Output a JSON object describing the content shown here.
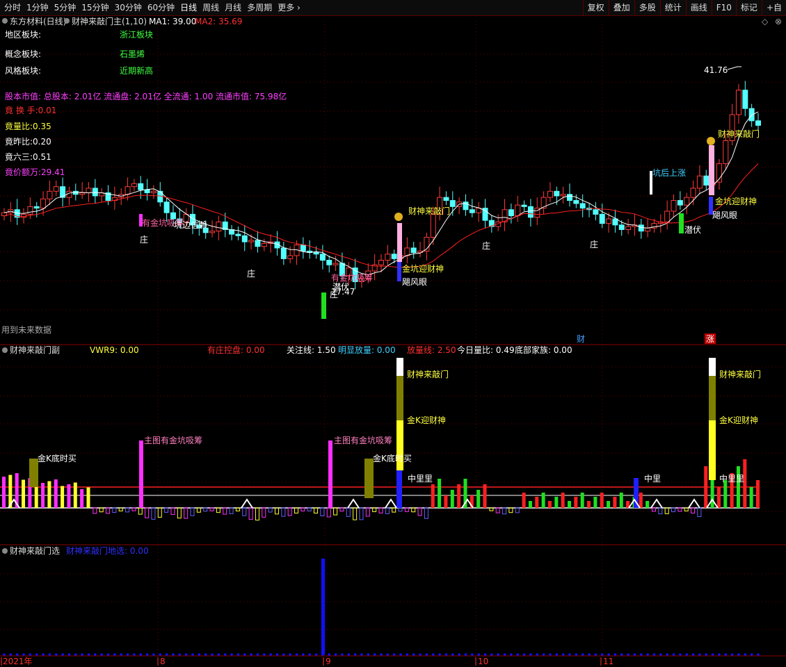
{
  "toolbar": {
    "left": [
      "分时",
      "1分钟",
      "5分钟",
      "15分钟",
      "30分钟",
      "60分钟",
      "日线",
      "周线",
      "月线",
      "多周期",
      "更多"
    ],
    "active": "日线",
    "right": [
      "复权",
      "叠加",
      "多股",
      "统计",
      "画线",
      "F10",
      "标记",
      "+自"
    ]
  },
  "main_panel": {
    "stock": "东方材料(日线)",
    "indicator": "财神来敲门主(1,10)",
    "ma1": "MA1: 39.00",
    "ma2": "MA2: 35.69",
    "info_rows": [
      {
        "label": "地区板块:",
        "value": "浙江板块"
      },
      {
        "label": "概念板块:",
        "value": "石墨烯"
      },
      {
        "label": "风格板块:",
        "value": "近期新高"
      }
    ],
    "market_value": "股本市值: 总股本: 2.01亿 流通盘: 2.01亿 全流通: 1.00 流通市值: 75.98亿",
    "stats": [
      {
        "text": "竟 换 手:0.01",
        "color": "#ff3030"
      },
      {
        "text": "竟量比:0.35",
        "color": "#ffff40"
      },
      {
        "text": "竟昨比:0.20",
        "color": "#ffffff"
      },
      {
        "text": "竟六三:0.51",
        "color": "#ffffff"
      },
      {
        "text": "竟价额万:29.41",
        "color": "#ff40ff"
      }
    ],
    "future_note": "用到未来数据",
    "high_label": "41.76",
    "low_label": "27.47",
    "bottom_tags": [
      "财",
      "涨"
    ]
  },
  "annotations_main": [
    {
      "text": "有金坑吸筹",
      "color": "#ff60a0"
    },
    {
      "text": "坑边信赖",
      "color": "#ffffff"
    },
    {
      "text": "庄",
      "color": "#ffffff"
    },
    {
      "text": "庄",
      "color": "#ffffff"
    },
    {
      "text": "有金坑吸筹",
      "color": "#ff60a0"
    },
    {
      "text": "潜伏",
      "color": "#ffffff"
    },
    {
      "text": "庄",
      "color": "#ffffff"
    },
    {
      "text": "财神来敲门",
      "color": "#ffff40"
    },
    {
      "text": "金坑迎财神",
      "color": "#ffff40"
    },
    {
      "text": "飓风眼",
      "color": "#ffffff"
    },
    {
      "text": "庄",
      "color": "#ffffff"
    },
    {
      "text": "庄",
      "color": "#ffffff"
    },
    {
      "text": "坑后上涨",
      "color": "#40d0ff"
    },
    {
      "text": "潜伏",
      "color": "#ffffff"
    },
    {
      "text": "财神来敲门",
      "color": "#ffff40"
    },
    {
      "text": "金坑迎财神",
      "color": "#ffff40"
    },
    {
      "text": "飓风眼",
      "color": "#ffffff"
    }
  ],
  "sub_panel": {
    "title": "财神来敲门副",
    "legend": [
      {
        "text": "VWR9: 0.00",
        "color": "#ffff40"
      },
      {
        "text": "有庄控盘: 0.00",
        "color": "#ff3030"
      },
      {
        "text": "关注线: 1.50",
        "color": "#ffffff"
      },
      {
        "text": "明显放量: 0.00",
        "color": "#40d0ff"
      },
      {
        "text": "放量线: 2.50",
        "color": "#ff3030"
      },
      {
        "text": "今日量比: 0.49",
        "color": "#ffffff"
      },
      {
        "text": "底部家族: 0.00",
        "color": "#ffffff"
      }
    ],
    "labels": [
      {
        "text": "金K底时买",
        "color": "#ffffff"
      },
      {
        "text": "主图有金坑吸筹",
        "color": "#ff80c0"
      },
      {
        "text": "主图有金坑吸筹",
        "color": "#ff80c0"
      },
      {
        "text": "金K底时买",
        "color": "#ffffff"
      },
      {
        "text": "财神来敲门",
        "color": "#ffff40"
      },
      {
        "text": "金K迎财神",
        "color": "#ffff40"
      },
      {
        "text": "中里里",
        "color": "#ffffff"
      },
      {
        "text": "中里",
        "color": "#ffffff"
      },
      {
        "text": "财神来敲门",
        "color": "#ffff40"
      },
      {
        "text": "金K迎财神",
        "color": "#ffff40"
      },
      {
        "text": "中里里",
        "color": "#ffffff"
      }
    ]
  },
  "select_panel": {
    "title": "财神来敲门选",
    "legend": "财神来敲门地选: 0.00"
  },
  "x_axis": [
    "2021年",
    "8",
    "9",
    "10",
    "11"
  ],
  "colors": {
    "up": "#ff3b3b",
    "down": "#54ffff",
    "ma1": "#ffffff",
    "ma2": "#ff2020",
    "grid": "#6a0000",
    "magenta": "#ff30ff",
    "blue": "#1010ff"
  }
}
